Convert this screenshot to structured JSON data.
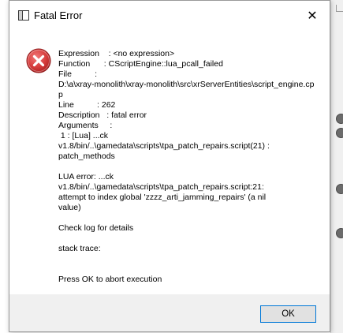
{
  "dialog": {
    "title": "Fatal Error",
    "icon": "error-icon",
    "message": "Expression    : <no expression>\nFunction      : CScriptEngine::lua_pcall_failed\nFile          :\nD:\\a\\xray-monolith\\xray-monolith\\src\\xrServerEntities\\script_engine.cpp\nLine          : 262\nDescription   : fatal error\nArguments     :\n 1 : [Lua] ...ck\nv1.8/bin/..\\gamedata\\scripts\\tpa_patch_repairs.script(21) :\npatch_methods\n\nLUA error: ...ck\nv1.8/bin/..\\gamedata\\scripts\\tpa_patch_repairs.script:21:\nattempt to index global 'zzzz_arti_jamming_repairs' (a nil\nvalue)\n\nCheck log for details\n\nstack trace:\n\n\nPress OK to abort execution",
    "ok_label": "OK",
    "close_glyph": "✕"
  },
  "colors": {
    "error_red": "#d63c3c",
    "button_focus_border": "#0078d7"
  }
}
